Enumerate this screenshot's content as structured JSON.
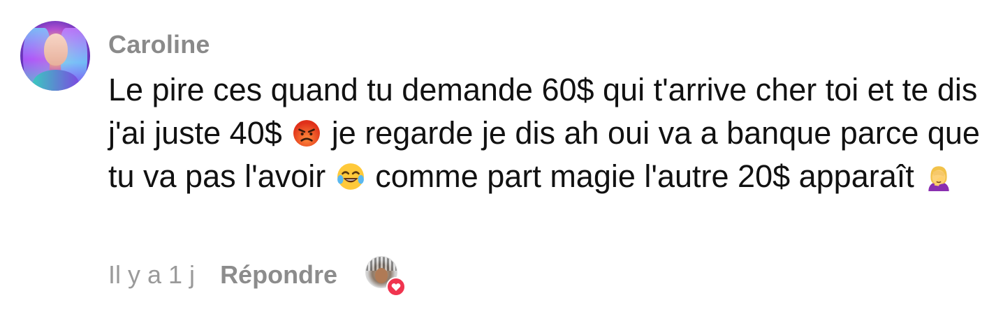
{
  "comment": {
    "username": "Caroline",
    "avatar_icon": "user-avatar",
    "text_parts": {
      "p1": "Le pire ces quand tu demande 60$ qui t'arrive cher toi et te dis j'ai juste 40$ ",
      "p2": " je regarde je dis ah oui va a banque parce que tu va pas l'avoir ",
      "p3": " comme part magie l'autre 20$ apparaît "
    },
    "emojis": [
      "angry-face-emoji",
      "tears-of-joy-emoji",
      "facepalm-emoji"
    ],
    "timestamp": "Il y a 1 j",
    "reply_label": "Répondre",
    "liked_by_creator_icon": "heart-icon"
  },
  "colors": {
    "username": "#8a8a8a",
    "text": "#111111",
    "meta": "#9a9a9a",
    "heart": "#f0344f"
  }
}
